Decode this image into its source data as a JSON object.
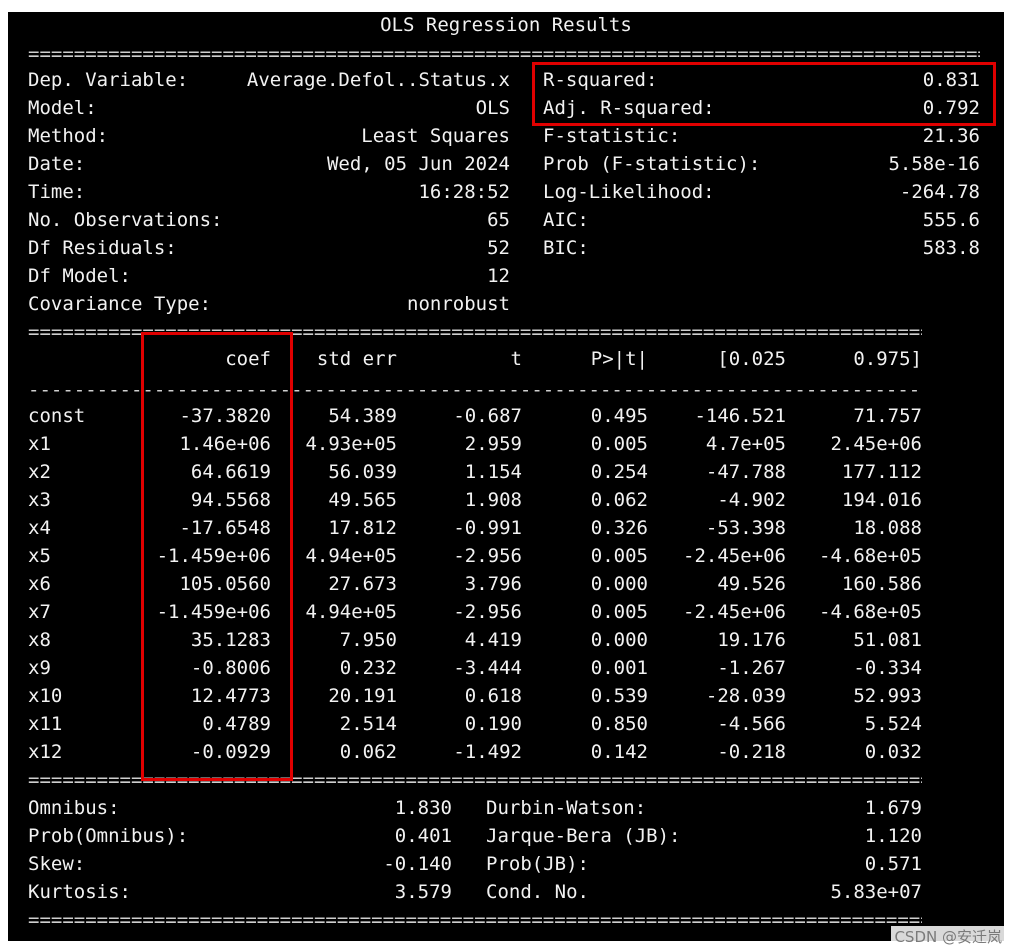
{
  "title": "OLS Regression Results",
  "highlight_color": "#e00000",
  "top_left": [
    {
      "label": "Dep. Variable:",
      "value": "Average.Defol..Status.x"
    },
    {
      "label": "Model:",
      "value": "OLS"
    },
    {
      "label": "Method:",
      "value": "Least Squares"
    },
    {
      "label": "Date:",
      "value": "Wed, 05 Jun 2024"
    },
    {
      "label": "Time:",
      "value": "16:28:52"
    },
    {
      "label": "No. Observations:",
      "value": "65"
    },
    {
      "label": "Df Residuals:",
      "value": "52"
    },
    {
      "label": "Df Model:",
      "value": "12"
    },
    {
      "label": "Covariance Type:",
      "value": "nonrobust"
    }
  ],
  "top_right": [
    {
      "label": "R-squared:",
      "value": "0.831"
    },
    {
      "label": "Adj. R-squared:",
      "value": "0.792"
    },
    {
      "label": "F-statistic:",
      "value": "21.36"
    },
    {
      "label": "Prob (F-statistic):",
      "value": "5.58e-16"
    },
    {
      "label": "Log-Likelihood:",
      "value": "-264.78"
    },
    {
      "label": "AIC:",
      "value": "555.6"
    },
    {
      "label": "BIC:",
      "value": "583.8"
    }
  ],
  "coef_headers": [
    "coef",
    "std err",
    "t",
    "P>|t|",
    "[0.025",
    "0.975]"
  ],
  "coef_rows": [
    [
      "const",
      "-37.3820",
      "54.389",
      "-0.687",
      "0.495",
      "-146.521",
      "71.757"
    ],
    [
      "x1",
      "1.46e+06",
      "4.93e+05",
      "2.959",
      "0.005",
      "4.7e+05",
      "2.45e+06"
    ],
    [
      "x2",
      "64.6619",
      "56.039",
      "1.154",
      "0.254",
      "-47.788",
      "177.112"
    ],
    [
      "x3",
      "94.5568",
      "49.565",
      "1.908",
      "0.062",
      "-4.902",
      "194.016"
    ],
    [
      "x4",
      "-17.6548",
      "17.812",
      "-0.991",
      "0.326",
      "-53.398",
      "18.088"
    ],
    [
      "x5",
      "-1.459e+06",
      "4.94e+05",
      "-2.956",
      "0.005",
      "-2.45e+06",
      "-4.68e+05"
    ],
    [
      "x6",
      "105.0560",
      "27.673",
      "3.796",
      "0.000",
      "49.526",
      "160.586"
    ],
    [
      "x7",
      "-1.459e+06",
      "4.94e+05",
      "-2.956",
      "0.005",
      "-2.45e+06",
      "-4.68e+05"
    ],
    [
      "x8",
      "35.1283",
      "7.950",
      "4.419",
      "0.000",
      "19.176",
      "51.081"
    ],
    [
      "x9",
      "-0.8006",
      "0.232",
      "-3.444",
      "0.001",
      "-1.267",
      "-0.334"
    ],
    [
      "x10",
      "12.4773",
      "20.191",
      "0.618",
      "0.539",
      "-28.039",
      "52.993"
    ],
    [
      "x11",
      "0.4789",
      "2.514",
      "0.190",
      "0.850",
      "-4.566",
      "5.524"
    ],
    [
      "x12",
      "-0.0929",
      "0.062",
      "-1.492",
      "0.142",
      "-0.218",
      "0.032"
    ]
  ],
  "bottom_left": [
    {
      "label": "Omnibus:",
      "value": "1.830"
    },
    {
      "label": "Prob(Omnibus):",
      "value": "0.401"
    },
    {
      "label": "Skew:",
      "value": "-0.140"
    },
    {
      "label": "Kurtosis:",
      "value": "3.579"
    }
  ],
  "bottom_right": [
    {
      "label": "Durbin-Watson:",
      "value": "1.679"
    },
    {
      "label": "Jarque-Bera (JB):",
      "value": "1.120"
    },
    {
      "label": "Prob(JB):",
      "value": "0.571"
    },
    {
      "label": "Cond. No.",
      "value": "5.83e+07"
    }
  ],
  "watermark": "CSDN @安迁岚"
}
